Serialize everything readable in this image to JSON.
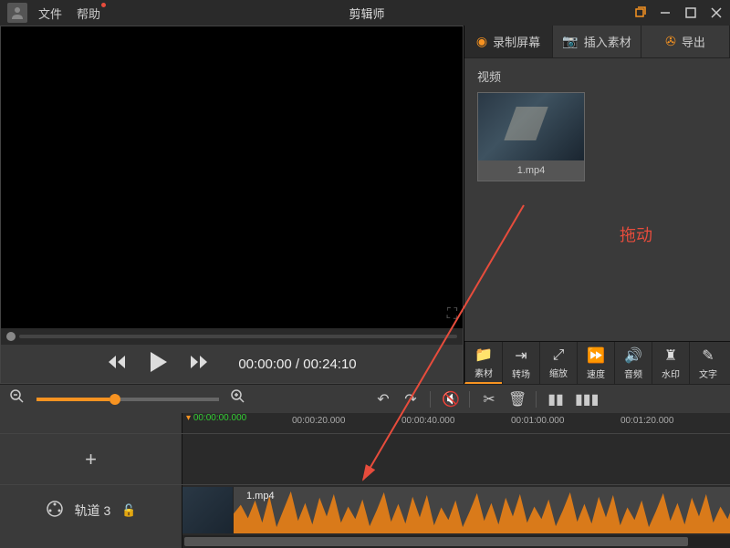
{
  "title": "剪辑师",
  "menu": {
    "file": "文件",
    "help": "帮助"
  },
  "actions": {
    "record": "录制屏幕",
    "insert": "插入素材",
    "export": "导出"
  },
  "media": {
    "section_label": "视频",
    "items": [
      {
        "name": "1.mp4"
      }
    ]
  },
  "drag_hint": "拖动",
  "playback": {
    "current": "00:00:00",
    "total": "00:24:10"
  },
  "tools": {
    "material": "素材",
    "transition": "转场",
    "scale": "缩放",
    "speed": "速度",
    "audio": "音频",
    "watermark": "水印",
    "text": "文字"
  },
  "timeline": {
    "playhead_tc": "00:00:00.000",
    "ticks": [
      "00:00:20.000",
      "00:00:40.000",
      "00:01:00.000",
      "00:01:20.000"
    ],
    "track_name": "轨道 3",
    "clip_name": "1.mp4"
  }
}
